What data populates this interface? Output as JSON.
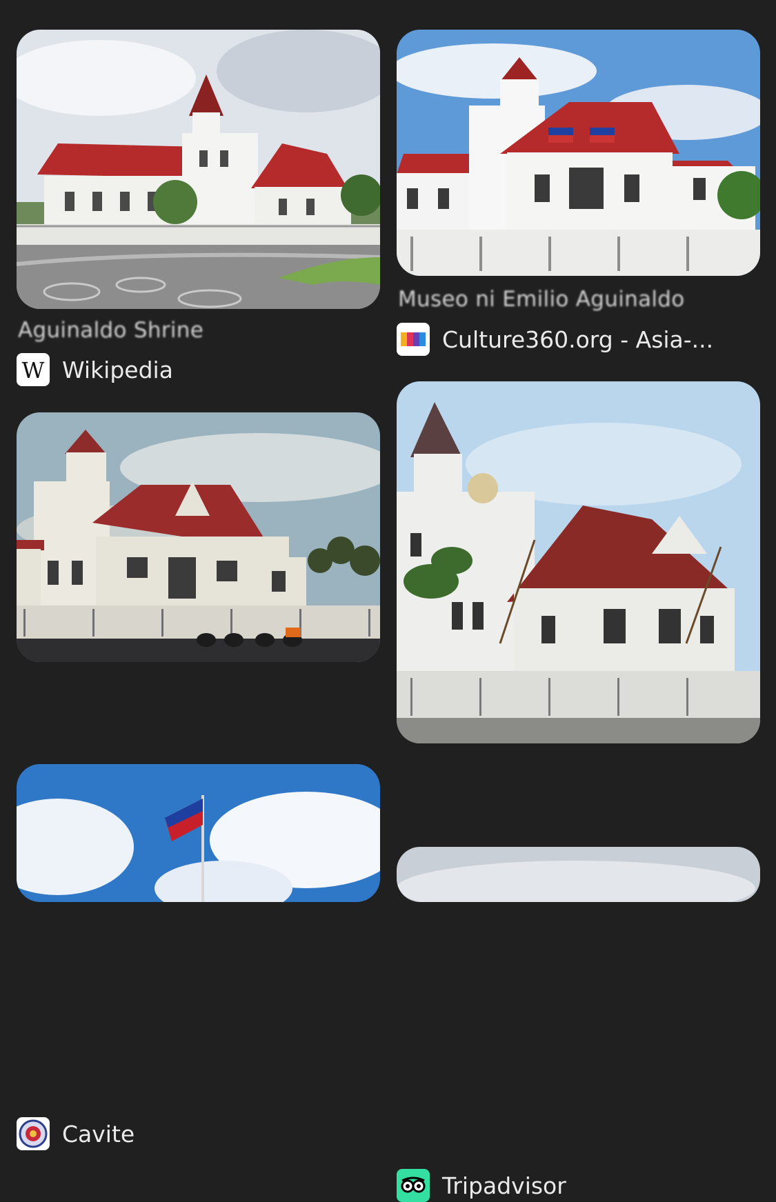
{
  "results": [
    {
      "title": "Aguinaldo Shrine",
      "source": "Wikipedia",
      "favicon_icon": "wikipedia-w-icon"
    },
    {
      "title": "Museo ni Emilio Aguinaldo",
      "source": "Culture360.org - Asia-...",
      "favicon_icon": "culture360-icon"
    },
    {
      "title": "",
      "source": "Cavite",
      "favicon_icon": "cavite-seal-icon"
    },
    {
      "title": "",
      "source": "Tripadvisor",
      "favicon_icon": "tripadvisor-owl-icon"
    }
  ],
  "colors": {
    "background": "#202020",
    "roof_red": "#b52b2b",
    "sky_blue": "#5c9ad6"
  }
}
